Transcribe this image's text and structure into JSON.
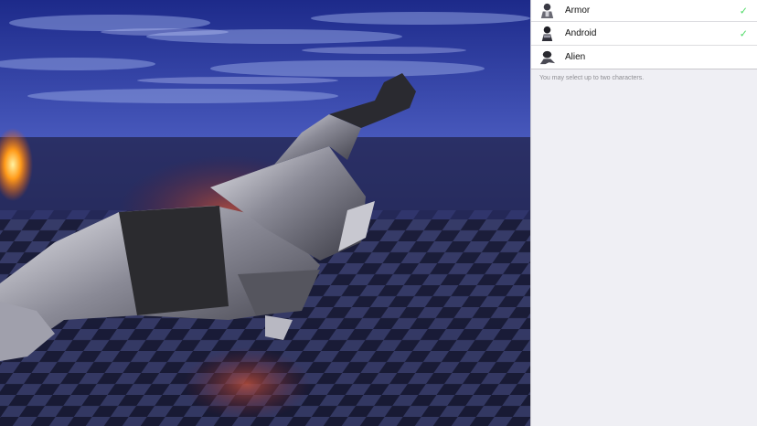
{
  "characters": {
    "items": [
      {
        "label": "Armor",
        "selected": true,
        "icon": "armor-avatar-icon"
      },
      {
        "label": "Android",
        "selected": true,
        "icon": "android-avatar-icon"
      },
      {
        "label": "Alien",
        "selected": false,
        "icon": "alien-avatar-icon"
      }
    ],
    "check_glyph": "✓",
    "note": "You may select up to two characters."
  },
  "colors": {
    "check": "#4cd964",
    "panel_bg": "#efeff4",
    "sky": "#3b4aa8"
  }
}
